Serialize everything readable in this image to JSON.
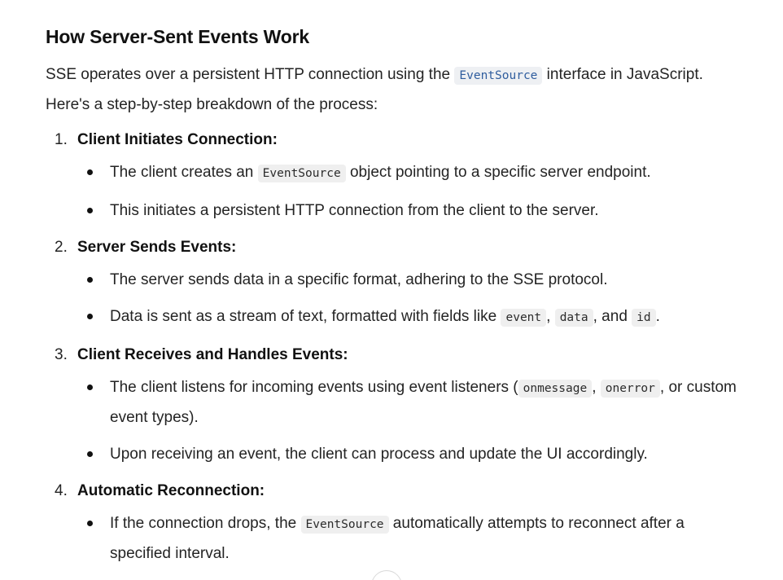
{
  "heading": "How Server-Sent Events Work",
  "intro": {
    "before": "SSE operates over a persistent HTTP connection using the ",
    "code": "EventSource",
    "after": " interface in JavaScript. Here's a step-by-step breakdown of the process:"
  },
  "steps": [
    {
      "number": "1.",
      "title": "Client Initiates Connection:",
      "bullets": [
        {
          "t1": "The client creates an ",
          "c1": "EventSource",
          "t2": " object pointing to a specific server endpoint."
        },
        {
          "t1": "This initiates a persistent HTTP connection from the client to the server."
        }
      ]
    },
    {
      "number": "2.",
      "title": "Server Sends Events:",
      "bullets": [
        {
          "t1": "The server sends data in a specific format, adhering to the SSE protocol."
        },
        {
          "t1": "Data is sent as a stream of text, formatted with fields like ",
          "c1": "event",
          "t2": ", ",
          "c2": "data",
          "t3": ", and ",
          "c3": "id",
          "t4": "."
        }
      ]
    },
    {
      "number": "3.",
      "title": "Client Receives and Handles Events:",
      "bullets": [
        {
          "t1": "The client listens for incoming events using event listeners (",
          "c1": "onmessage",
          "t2": ", ",
          "c2": "onerror",
          "t3": ", or custom event types)."
        },
        {
          "t1": "Upon receiving an event, the client can process and update the UI accordingly."
        }
      ]
    },
    {
      "number": "4.",
      "title": "Automatic Reconnection:",
      "bullets": [
        {
          "t1": "If the connection drops, the ",
          "c1": "EventSource",
          "t2": " automatically attempts to reconnect after a specified interval."
        }
      ]
    }
  ]
}
